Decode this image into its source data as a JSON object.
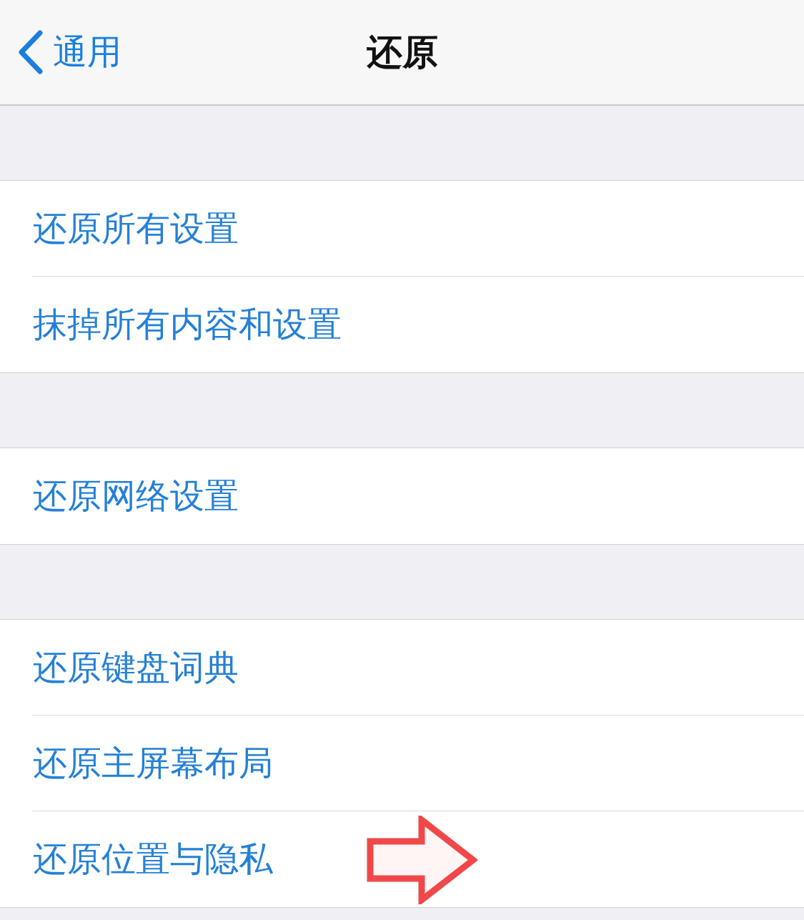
{
  "nav_bar": {
    "back_label": "通用",
    "title": "还原"
  },
  "groups": [
    {
      "rows": [
        {
          "label": "还原所有设置",
          "arrow_marker": false
        },
        {
          "label": "抹掉所有内容和设置",
          "arrow_marker": false
        }
      ]
    },
    {
      "rows": [
        {
          "label": "还原网络设置",
          "arrow_marker": false
        }
      ]
    },
    {
      "rows": [
        {
          "label": "还原键盘词典",
          "arrow_marker": false
        },
        {
          "label": "还原主屏幕布局",
          "arrow_marker": false
        },
        {
          "label": "还原位置与隐私",
          "arrow_marker": true
        }
      ]
    }
  ]
}
